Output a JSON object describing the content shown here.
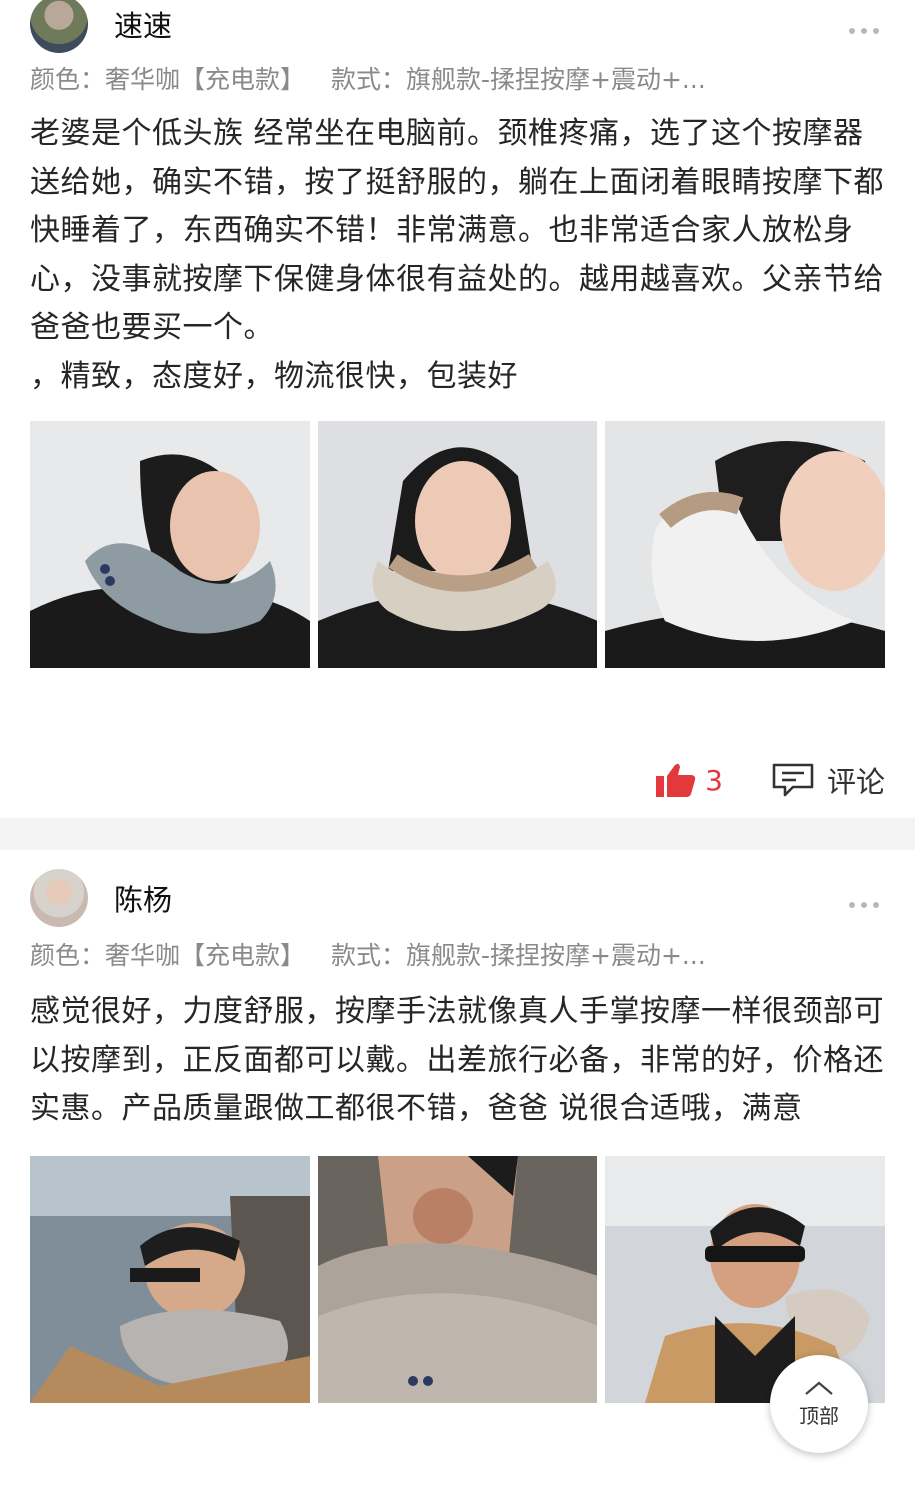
{
  "reviews": [
    {
      "username": "速速",
      "spec_color": "颜色：奢华咖【充电款】",
      "spec_style": "款式：旗舰款-揉捏按摩+震动+...",
      "text": "老婆是个低头族 经常坐在电脑前。颈椎疼痛，选了这个按摩器送给她，确实不错，按了挺舒服的，躺在上面闭着眼睛按摩下都快睡着了，东西确实不错！非常满意。也非常适合家人放松身心，没事就按摩下保健身体很有益处的。越用越喜欢。父亲节给爸爸也要买一个。",
      "tags": "，精致，态度好，物流很快，包装好",
      "like_count": "3",
      "comment_label": "评论"
    },
    {
      "username": "陈杨",
      "spec_color": "颜色：奢华咖【充电款】",
      "spec_style": "款式：旗舰款-揉捏按摩+震动+...",
      "text": "感觉很好，力度舒服，按摩手法就像真人手掌按摩一样很颈部可以按摩到，正反面都可以戴。出差旅行必备，非常的好，价格还实惠。产品质量跟做工都很不错，爸爸 说很合适哦，满意"
    }
  ],
  "back_to_top_label": "顶部",
  "colors": {
    "accent": "#e4393c",
    "separator": "#f3f3f3",
    "meta": "#8a8a8a"
  },
  "icons": [
    "more-icon",
    "thumbs-up-icon",
    "comment-icon",
    "chevron-up-icon"
  ]
}
